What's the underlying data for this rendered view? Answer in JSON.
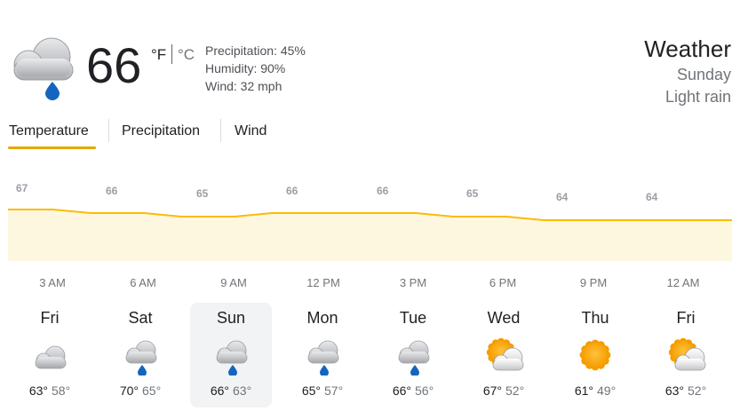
{
  "current": {
    "icon": "rain-cloud-icon",
    "temperature": "66",
    "unit_f": "°F",
    "unit_c": "°C",
    "precipitation": "Precipitation: 45%",
    "humidity": "Humidity: 90%",
    "wind": "Wind: 32 mph"
  },
  "header": {
    "title": "Weather",
    "day": "Sunday",
    "condition": "Light rain"
  },
  "tabs": [
    {
      "label": "Temperature",
      "active": true
    },
    {
      "label": "Precipitation",
      "active": false
    },
    {
      "label": "Wind",
      "active": false
    }
  ],
  "chart_data": {
    "type": "area",
    "values": [
      67,
      66,
      65,
      66,
      66,
      65,
      64,
      64
    ],
    "value_labels": [
      "67",
      "66",
      "65",
      "66",
      "66",
      "65",
      "64",
      "64"
    ],
    "categories": [
      "",
      "3 AM",
      "6 AM",
      "9 AM",
      "12 PM",
      "3 PM",
      "6 PM",
      "9 PM",
      "12 AM"
    ],
    "line_color": "#fbbc04",
    "fill_color": "#fef7e0"
  },
  "time_labels": [
    "3 AM",
    "6 AM",
    "9 AM",
    "12 PM",
    "3 PM",
    "6 PM",
    "9 PM",
    "12 AM"
  ],
  "days": [
    {
      "name": "Fri",
      "icon": "cloud-icon",
      "high": "63°",
      "low": "58°",
      "selected": false
    },
    {
      "name": "Sat",
      "icon": "rain-cloud-icon",
      "high": "70°",
      "low": "65°",
      "selected": false
    },
    {
      "name": "Sun",
      "icon": "rain-cloud-icon",
      "high": "66°",
      "low": "63°",
      "selected": true
    },
    {
      "name": "Mon",
      "icon": "rain-cloud-icon",
      "high": "65°",
      "low": "57°",
      "selected": false
    },
    {
      "name": "Tue",
      "icon": "rain-cloud-icon",
      "high": "66°",
      "low": "56°",
      "selected": false
    },
    {
      "name": "Wed",
      "icon": "partly-cloudy-icon",
      "high": "67°",
      "low": "52°",
      "selected": false
    },
    {
      "name": "Thu",
      "icon": "sun-icon",
      "high": "61°",
      "low": "49°",
      "selected": false
    },
    {
      "name": "Fri",
      "icon": "partly-cloudy-icon",
      "high": "63°",
      "low": "52°",
      "selected": false
    }
  ]
}
